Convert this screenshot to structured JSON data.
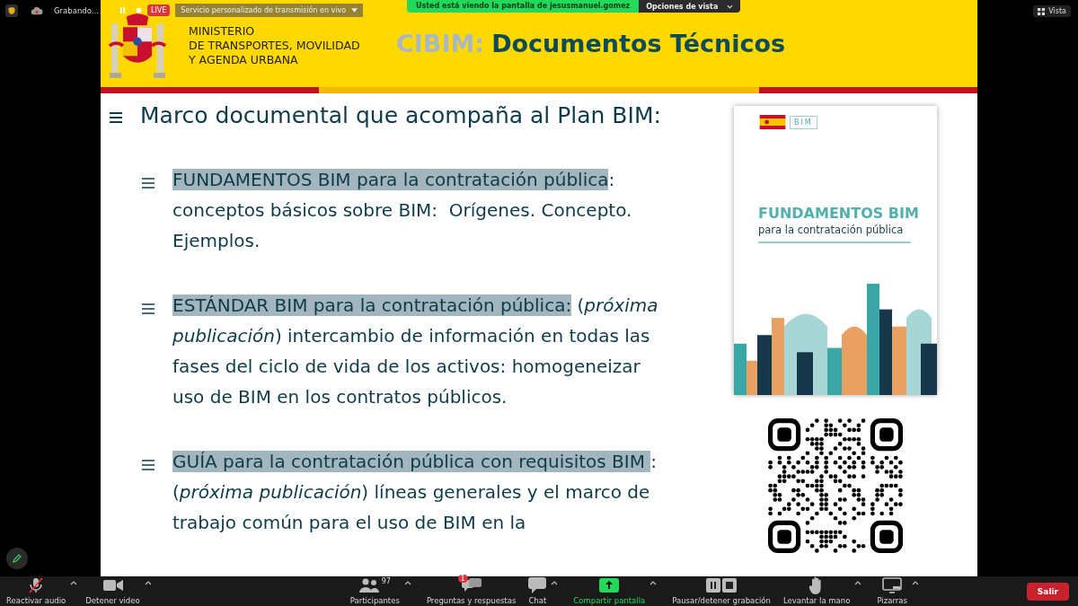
{
  "recording": {
    "status": "Grabando...",
    "live_badge": "LIVE",
    "stream_menu": "Servicio personalizado de transmisión en vivo"
  },
  "share_banner": {
    "text": "Usted está viendo la pantalla de jesusmanuel.gomez",
    "view_options": "Opciones de vista"
  },
  "view_button": "Vista",
  "slide": {
    "ministry": [
      "MINISTERIO",
      "DE TRANSPORTES, MOVILIDAD",
      "Y AGENDA URBANA"
    ],
    "title_prefix": "CIBIM:",
    "title": "Documentos Técnicos",
    "heading": "Marco documental que acompaña al Plan BIM:",
    "items": [
      {
        "highlight": "FUNDAMENTOS BIM para la contratación pública",
        "text": ": conceptos básicos sobre BIM:  Orígenes. Concepto. Ejemplos."
      },
      {
        "highlight": "ESTÁNDAR BIM para la contratación pública:",
        "text": " (*próxima publicación*) intercambio de información en todas las fases del ciclo de vida de los activos: homogeneizar uso de BIM en los contratos públicos."
      },
      {
        "highlight": "GUÍA para la contratación pública con requisitos BIM ",
        "text": ": (*próxima publicación*) líneas generales y el marco de trabajo común para el uso de BIM en la"
      }
    ],
    "cover": {
      "badge": "BIM",
      "title": "FUNDAMENTOS BIM",
      "subtitle": "para la contratación pública"
    }
  },
  "toolbar": {
    "items": [
      {
        "label": "Reactivar audio",
        "kind": "mic-muted",
        "caret": true
      },
      {
        "label": "Detener video",
        "kind": "video",
        "caret": true
      },
      {
        "label": "Participantes",
        "kind": "people",
        "count": "97",
        "caret": true
      },
      {
        "label": "Preguntas y respuestas",
        "kind": "qa",
        "badge": "1",
        "caret": false
      },
      {
        "label": "Chat",
        "kind": "chat",
        "caret": true
      },
      {
        "label": "Compartir pantalla",
        "kind": "share",
        "caret": true
      },
      {
        "label": "Pausar/detener grabación",
        "kind": "record",
        "caret": false
      },
      {
        "label": "Levantar la mano",
        "kind": "hand",
        "caret": true
      },
      {
        "label": "Pizarras",
        "kind": "board",
        "caret": true
      }
    ],
    "leave": "Salir"
  }
}
